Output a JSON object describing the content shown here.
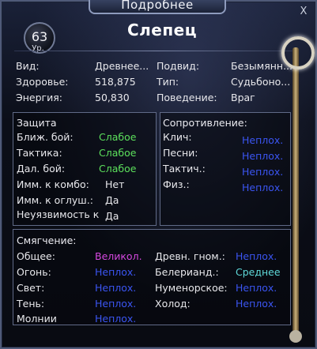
{
  "window": {
    "title": "Подробнее",
    "close_glyph": "X"
  },
  "mob": {
    "level": "63",
    "level_label": "Ур.",
    "name": "Слепец"
  },
  "info": {
    "rows": [
      {
        "l1": "Вид:",
        "v1": "Древнее...",
        "l2": "Подвид:",
        "v2": "Безымянн..."
      },
      {
        "l1": "Здоровье:",
        "v1": "518,875",
        "l2": "Тип:",
        "v2": "Судьбоно..."
      },
      {
        "l1": "Энергия:",
        "v1": "50,830",
        "l2": "Поведение:",
        "v2": "Враг"
      }
    ]
  },
  "defense": {
    "title": "Защита",
    "rows": [
      {
        "label": "Ближ. бой:",
        "value": "Слабое",
        "color": "#5ce05c"
      },
      {
        "label": "Тактика:",
        "value": "Слабое",
        "color": "#5ce05c"
      },
      {
        "label": "Дал. бой:",
        "value": "Слабое",
        "color": "#5ce05c"
      },
      {
        "label": "Имм. к комбо:",
        "value": "Нет",
        "color": "#e8e8ec"
      },
      {
        "label": "Имм. к оглуш.:",
        "value": "Да",
        "color": "#e8e8ec"
      },
      {
        "label": "Неуязвимость к",
        "value": "Да",
        "color": "#e8e8ec"
      }
    ]
  },
  "resistance": {
    "title": "Сопротивление:",
    "rows": [
      {
        "label": "Клич:",
        "value": "Неплох."
      },
      {
        "label": "Песни:",
        "value": "Неплох."
      },
      {
        "label": "Тактич.:",
        "value": "Неплох."
      },
      {
        "label": "Физ.:",
        "value": "Неплох."
      }
    ]
  },
  "mitigation": {
    "title": "Смягчение:",
    "left": [
      {
        "label": "Общее:",
        "value": "Великол.",
        "color": "#d548e0"
      },
      {
        "label": "Огонь:",
        "value": "Неплох.",
        "color": "#3b55f2"
      },
      {
        "label": "Свет:",
        "value": "Неплох.",
        "color": "#3b55f2"
      },
      {
        "label": "Тень:",
        "value": "Неплох.",
        "color": "#3b55f2"
      },
      {
        "label": "Молнии",
        "value": "Неплох.",
        "color": "#3b55f2"
      }
    ],
    "right": [
      {
        "label": "Древн. гном.:",
        "value": "Неплох.",
        "color": "#3b55f2"
      },
      {
        "label": "Белерианд.:",
        "value": "Среднее",
        "color": "#5fd9d9"
      },
      {
        "label": "Нуменорское:",
        "value": "Неплох.",
        "color": "#3b55f2"
      },
      {
        "label": "Холод:",
        "value": "Неплох.",
        "color": "#3b55f2"
      }
    ]
  },
  "icons": [
    "staff-ornament-icon",
    "close-icon",
    "level-badge-icon"
  ]
}
